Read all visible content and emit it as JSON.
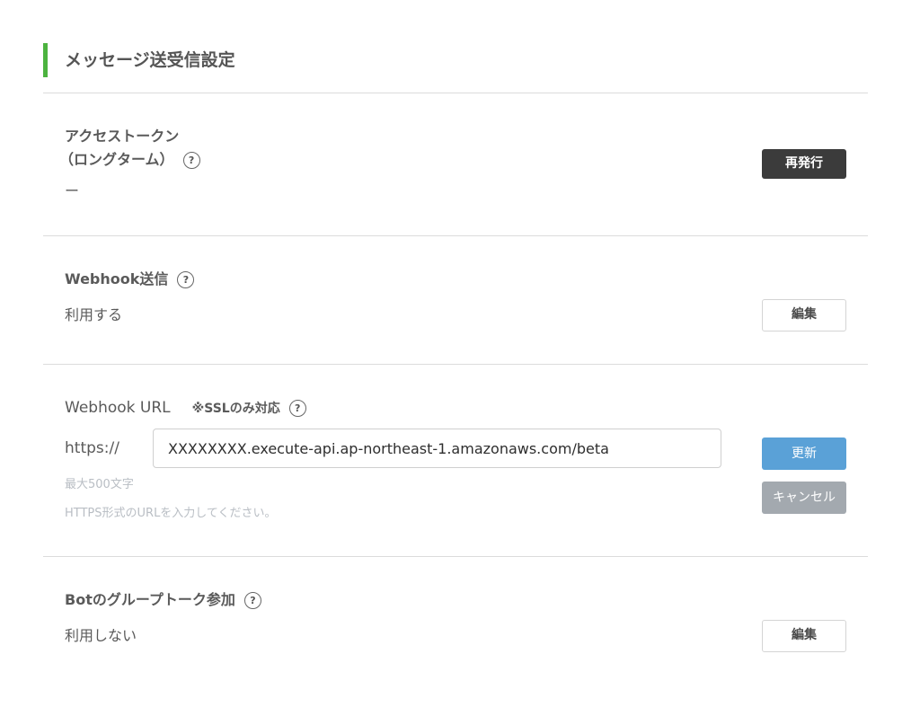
{
  "section": {
    "title": "メッセージ送受信設定",
    "accent_color": "#4cb33f"
  },
  "access_token": {
    "title_line1": "アクセストークン",
    "title_line2": "（ロングターム）",
    "value": "ー",
    "button_label": "再発行"
  },
  "webhook_send": {
    "title": "Webhook送信",
    "value": "利用する",
    "button_label": "編集"
  },
  "webhook_url": {
    "title": "Webhook URL",
    "ssl_note": "※SSLのみ対応",
    "prefix": "https://",
    "input_value": "XXXXXXXX.execute-api.ap-northeast-1.amazonaws.com/beta",
    "hint_max": "最大500文字",
    "hint_format": "HTTPS形式のURLを入力してください。",
    "update_label": "更新",
    "cancel_label": "キャンセル"
  },
  "bot_group": {
    "title": "Botのグループトーク参加",
    "value": "利用しない",
    "button_label": "編集"
  },
  "help_glyph": "?",
  "colors": {
    "primary_button": "#5aa1d7",
    "dark_button": "#3b3b3b",
    "disabled_button": "#a3a9af"
  }
}
